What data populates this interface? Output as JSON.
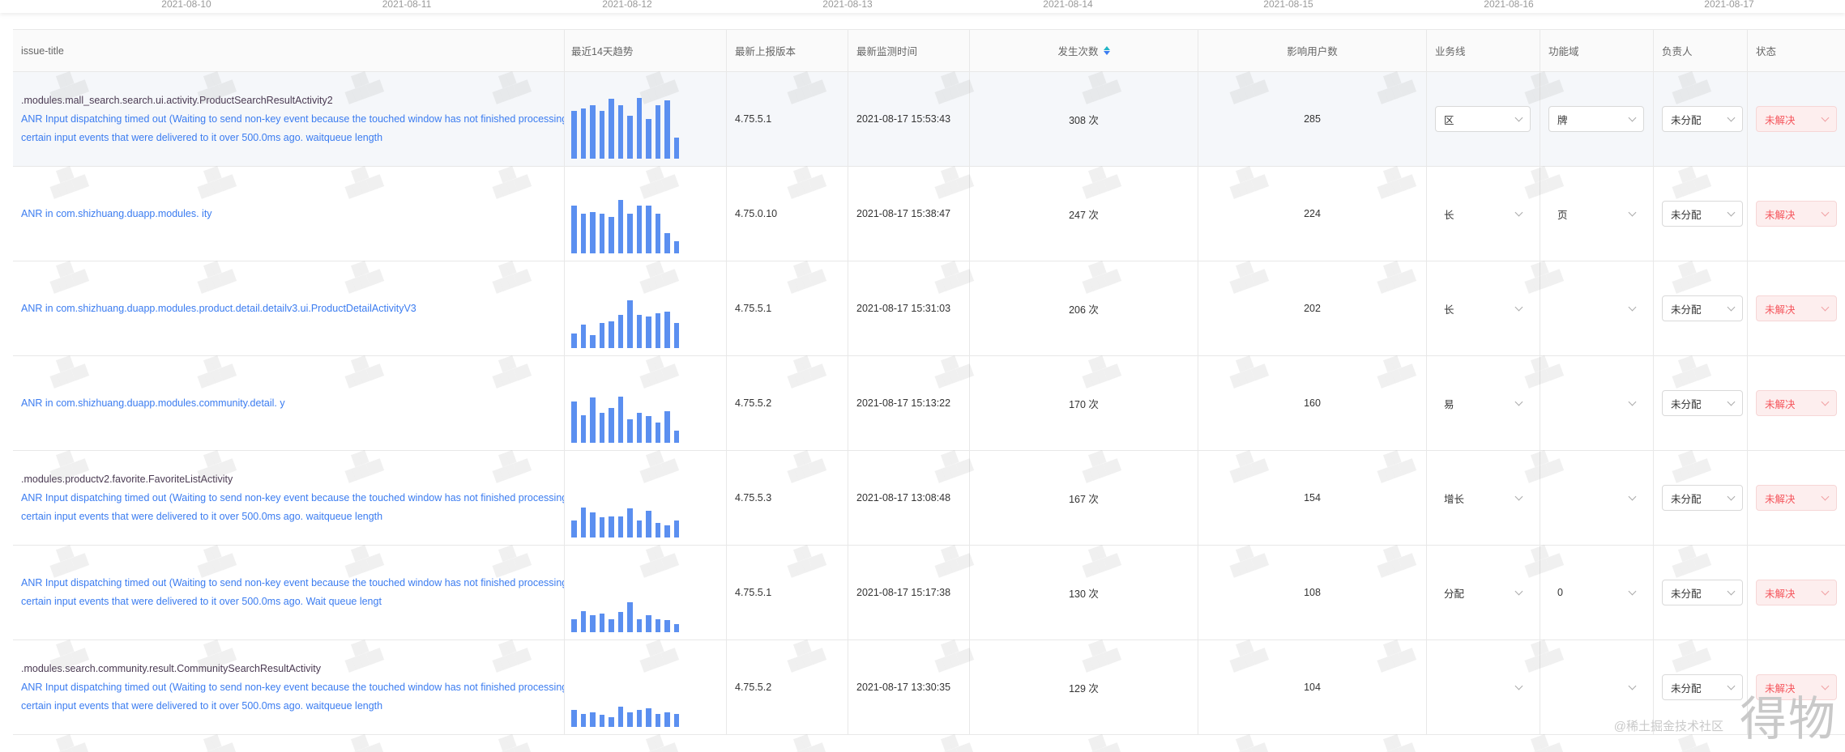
{
  "date_axis": [
    "2021-08-10",
    "2021-08-11",
    "2021-08-12",
    "2021-08-13",
    "2021-08-14",
    "2021-08-15",
    "2021-08-16",
    "2021-08-17"
  ],
  "columns": {
    "title": "issue-title",
    "trend": "最近14天趋势",
    "version": "最新上报版本",
    "time": "最新监测时间",
    "count": "发生次数",
    "users": "影响用户数",
    "biz": "业务线",
    "func": "功能域",
    "owner": "负责人",
    "status": "状态"
  },
  "rows": [
    {
      "main": ".modules.mall_search.search.ui.activity.ProductSearchResultActivity2",
      "link1": "ANR Input dispatching timed out (Waiting to send non-key event because the touched window has not finished processing",
      "link2": "certain input events that were delivered to it over 500.0ms ago. waitqueue length",
      "trend": [
        0.72,
        0.75,
        0.8,
        0.72,
        0.9,
        0.8,
        0.65,
        0.92,
        0.6,
        0.8,
        0.88,
        0.32
      ],
      "version": "4.75.5.1",
      "time": "2021-08-17 15:53:43",
      "count": "308 次",
      "users": "285",
      "biz": "区",
      "func": "牌",
      "owner": "未分配",
      "status": "未解决"
    },
    {
      "main": "",
      "link1": "ANR in com.shizhuang.duapp.modules.              ity",
      "link2": "",
      "trend": [
        0.72,
        0.6,
        0.62,
        0.6,
        0.55,
        0.8,
        0.6,
        0.72,
        0.72,
        0.6,
        0.3,
        0.18
      ],
      "version": "4.75.0.10",
      "time": "2021-08-17 15:38:47",
      "count": "247 次",
      "users": "224",
      "biz": "长",
      "func": "页",
      "owner": "未分配",
      "status": "未解决"
    },
    {
      "main": "",
      "link1": "ANR in com.shizhuang.duapp.modules.product.detail.detailv3.ui.ProductDetailActivityV3",
      "link2": "",
      "trend": [
        0.22,
        0.35,
        0.2,
        0.38,
        0.4,
        0.5,
        0.72,
        0.5,
        0.48,
        0.52,
        0.55,
        0.38
      ],
      "version": "4.75.5.1",
      "time": "2021-08-17 15:31:03",
      "count": "206 次",
      "users": "202",
      "biz": "长",
      "func": "",
      "owner": "未分配",
      "status": "未解决"
    },
    {
      "main": "",
      "link1": "ANR in com.shizhuang.duapp.modules.community.detail.               y",
      "link2": "",
      "trend": [
        0.62,
        0.42,
        0.68,
        0.45,
        0.52,
        0.7,
        0.35,
        0.45,
        0.4,
        0.3,
        0.48,
        0.18
      ],
      "version": "4.75.5.2",
      "time": "2021-08-17 15:13:22",
      "count": "170 次",
      "users": "160",
      "biz": "易",
      "func": "",
      "owner": "未分配",
      "status": "未解决"
    },
    {
      "main": ".modules.productv2.favorite.FavoriteListActivity",
      "link1": "ANR Input dispatching timed out (Waiting to send non-key event because the touched window has not finished processing",
      "link2": "certain input events that were delivered to it over 500.0ms ago. waitqueue length",
      "trend": [
        0.25,
        0.45,
        0.38,
        0.3,
        0.32,
        0.32,
        0.44,
        0.25,
        0.4,
        0.22,
        0.18,
        0.25
      ],
      "version": "4.75.5.3",
      "time": "2021-08-17 13:08:48",
      "count": "167 次",
      "users": "154",
      "biz": "增长",
      "func": "",
      "owner": "未分配",
      "status": "未解决"
    },
    {
      "main": "",
      "link1": "ANR Input dispatching timed out (Waiting to send non-key event because the touched window has not finished processing",
      "link2": "certain input events that were delivered to it over 500.0ms ago. Wait queue lengt",
      "trend": [
        0.2,
        0.32,
        0.25,
        0.28,
        0.2,
        0.3,
        0.45,
        0.2,
        0.25,
        0.2,
        0.18,
        0.12
      ],
      "version": "4.75.5.1",
      "time": "2021-08-17 15:17:38",
      "count": "130 次",
      "users": "108",
      "biz": "分配",
      "func": "0",
      "owner": "未分配",
      "status": "未解决"
    },
    {
      "main": ".modules.search.community.result.CommunitySearchResultActivity",
      "link1": "ANR Input dispatching timed out (Waiting to send non-key event because the touched window has not finished processing",
      "link2": "certain input events that were delivered to it over 500.0ms ago. waitqueue length",
      "trend": [
        0.25,
        0.2,
        0.22,
        0.18,
        0.15,
        0.3,
        0.22,
        0.25,
        0.28,
        0.2,
        0.22,
        0.2
      ],
      "version": "4.75.5.2",
      "time": "2021-08-17 13:30:35",
      "count": "129 次",
      "users": "104",
      "biz": "",
      "func": "",
      "owner": "未分配",
      "status": "未解决"
    }
  ],
  "corner": {
    "credit": "@稀土掘金技术社区",
    "logo": "得物"
  }
}
